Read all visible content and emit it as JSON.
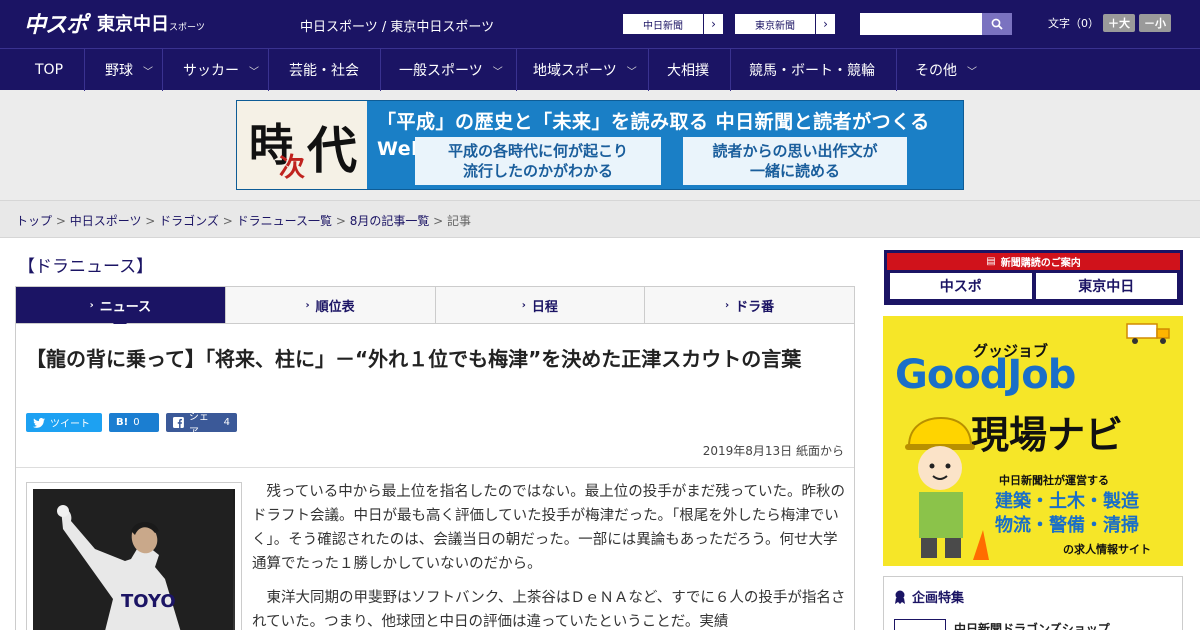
{
  "header": {
    "logo_main": "中スポ",
    "logo_sub": "東京中日",
    "logo_sub_small": "スポーツ",
    "site_name": "中日スポーツ / 東京中日スポーツ",
    "btn1": "中日新聞",
    "btn2": "東京新聞",
    "search_placeholder": "",
    "font_label": "文字（0）",
    "font_plus": "＋大",
    "font_minus": "－小"
  },
  "nav": [
    {
      "label": "TOP",
      "chevron": false
    },
    {
      "label": "野球",
      "chevron": true
    },
    {
      "label": "サッカー",
      "chevron": true
    },
    {
      "label": "芸能・社会",
      "chevron": false
    },
    {
      "label": "一般スポーツ",
      "chevron": true
    },
    {
      "label": "地域スポーツ",
      "chevron": true
    },
    {
      "label": "大相撲",
      "chevron": false
    },
    {
      "label": "競馬・ボート・競輪",
      "chevron": false
    },
    {
      "label": "その他",
      "chevron": true
    }
  ],
  "banner": {
    "char1": "時",
    "char2": "次",
    "char3": "代",
    "headline": "「平成」の歴史と「未来」を読み取る 中日新聞と読者がつくるWebサイト",
    "box1": "平成の各時代に何が起こり\n流行したのかがわかる",
    "box2": "読者からの思い出作文が\n一緒に読める"
  },
  "breadcrumb": {
    "items": [
      "トップ",
      "中日スポーツ",
      "ドラゴンズ",
      "ドラニュース一覧",
      "8月の記事一覧"
    ],
    "current": "記事",
    "sep": " > "
  },
  "section_title": "【ドラニュース】",
  "tabs": [
    {
      "label": "ニュース",
      "active": true
    },
    {
      "label": "順位表",
      "active": false
    },
    {
      "label": "日程",
      "active": false
    },
    {
      "label": "ドラ番",
      "active": false
    }
  ],
  "article": {
    "title": "【龍の背に乗って】「将来、柱に」－“外れ１位でも梅津”を決めた正津スカウトの言葉",
    "share_tweet": "ツイート",
    "share_hatena": "B!",
    "share_hatena_count": "0",
    "share_fb": "シェア",
    "share_fb_count": "4",
    "date": "2019年8月13日 紙面から",
    "paragraphs": [
      "残っている中から最上位を指名したのではない。最上位の投手がまだ残っていた。昨秋のドラフト会議。中日が最も高く評価していた投手が梅津だった。「根尾を外したら梅津でいく」。そう確認されたのは、会議当日の朝だった。一部には異論もあっただろう。何せ大学通算でたった１勝しかしていないのだから。",
      "東洋大同期の甲斐野はソフトバンク、上茶谷はＤｅＮＡなど、すでに６人の投手が指名されていた。つまり、他球団と中日の評価は違っていたということだ。実績"
    ]
  },
  "sidebar": {
    "ad1_head": "新聞購読のご案内",
    "ad1_logo1": "中スポ",
    "ad1_logo2": "東京中日",
    "ad2_top": "グッジョブ",
    "ad2_main": "GoodJob",
    "ad2_sub": "現場ナビ",
    "ad2_line1": "中日新聞社が運営する",
    "ad2_line2": "建築・土木・製造",
    "ad2_line3": "物流・警備・清掃",
    "ad2_line4": "の求人情報サイト",
    "box_title": "企画特集",
    "box_item": "中日新聞ドラゴンズショップ"
  },
  "colors": {
    "brand": "#1b1464",
    "accent_red": "#d0121b",
    "ad_yellow": "#f6e628"
  }
}
